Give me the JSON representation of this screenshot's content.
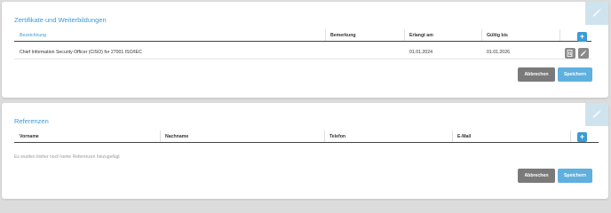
{
  "certificates": {
    "title": "Zertifikate und Weiterbildungen",
    "columns": {
      "name": "Bezeichnung",
      "remark": "Bemerkung",
      "obtained": "Erlangt am",
      "valid_until": "Gültig bis"
    },
    "rows": [
      {
        "name": "Chief Information Security Officer (CISO) for 27001 ISO/IEC",
        "remark": "",
        "obtained": "01.01.2024",
        "valid_until": "01.01.2026"
      }
    ],
    "add_label": "+",
    "cancel_label": "Abbrechen",
    "save_label": "Speichern"
  },
  "references": {
    "title": "Referenzen",
    "columns": {
      "first_name": "Vorname",
      "last_name": "Nachname",
      "phone": "Telefon",
      "email": "E-Mail"
    },
    "empty_text": "Es wurden bisher noch keine Referenzen hinzugefügt",
    "add_label": "+",
    "cancel_label": "Abbrechen",
    "save_label": "Speichern"
  },
  "colors": {
    "accent": "#3a9bd5",
    "cancel": "#7a7a7a",
    "save": "#5fb0de"
  }
}
